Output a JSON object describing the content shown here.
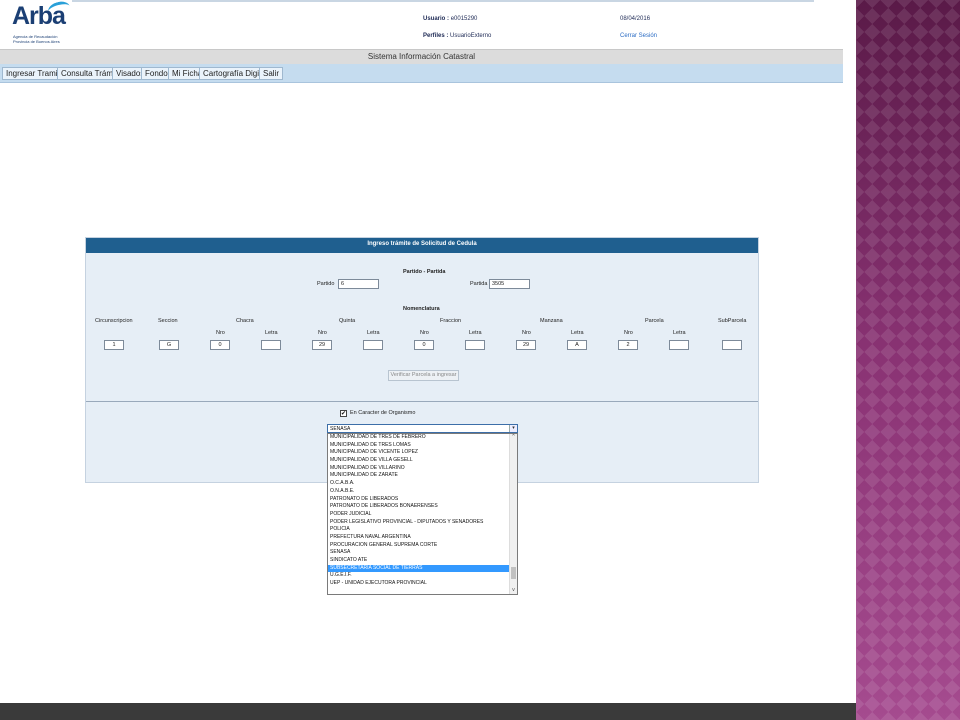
{
  "header": {
    "logo_text": "Arba",
    "logo_subtitle_1": "Agencia de Recaudación",
    "logo_subtitle_2": "Provincia de Buenos Aires",
    "usuario_label": "Usuario :",
    "usuario_value": "e0015290",
    "perfiles_label": "Perfiles :",
    "perfiles_value": "UsuarioExterno",
    "date": "08/04/2016",
    "logout_label": "Cerrar Sesión"
  },
  "system_title": "Sistema Información Catastral",
  "nav": {
    "items": [
      "Ingresar Tramite",
      "Consulta Trámite",
      "Visados",
      "Fondos",
      "Mi Ficha",
      "Cartografía Digital",
      "Salir"
    ]
  },
  "form": {
    "title": "Ingreso trámite de Solicitud de Cedula",
    "partido_section": "Partido - Partida",
    "partido_label": "Partido",
    "partido_value": "6",
    "partida_label": "Partida",
    "partida_value": "3505",
    "nomenclatura_section": "Nomenclatura",
    "col_labels": {
      "circunscripcion": "Circunscripcion",
      "seccion": "Seccion",
      "chacra": "Chacra",
      "quinta": "Quinta",
      "fraccion": "Fraccion",
      "manzana": "Manzana",
      "parcela": "Parcela",
      "subparcela": "SubParcela",
      "nro": "Nro",
      "letra": "Letra"
    },
    "values": {
      "circunscripcion": "1",
      "seccion": "G",
      "chacra_nro": "0",
      "chacra_letra": "",
      "quinta_nro": "29",
      "quinta_letra": "",
      "fraccion_nro": "0",
      "fraccion_letra": "",
      "manzana_nro": "29",
      "manzana_letra": "A",
      "parcela_nro": "2",
      "parcela_letra": "",
      "subparcela": ""
    },
    "verify_button": "Verificar Parcela a ingresar",
    "organismo_checkbox_label": "En Caracter de Organismo",
    "organismo_checked": true
  },
  "dropdown": {
    "selected_value": "SENASA",
    "options": [
      "MUNICIPALIDAD DE TRES DE FEBRERO",
      "MUNICIPALIDAD DE TRES LOMAS",
      "MUNICIPALIDAD DE VICENTE LOPEZ",
      "MUNICIPALIDAD DE VILLA GESELL",
      "MUNICIPALIDAD DE VILLARINO",
      "MUNICIPALIDAD DE ZARATE",
      "O.C.A.B.A.",
      "O.N.A.B.E.",
      "PATRONATO DE LIBERADOS",
      "PATRONATO DE LIBERADOS BONAERENSES",
      "PODER JUDICIAL",
      "PODER LEGISLATIVO PROVINCIAL - DIPUTADOS Y SENADORES",
      "POLICIA",
      "PREFECTURA NAVAL ARGENTINA",
      "PROCURACION GENERAL SUPREMA CORTE",
      "SENASA",
      "SINDICATO ATE",
      "SUBSECRETARIA SOCIAL DE TIERRAS",
      "U.G.E.I.F.",
      "UEP - UNIDAD EJECUTORA PROVINCIAL"
    ],
    "highlighted_index": 17
  }
}
